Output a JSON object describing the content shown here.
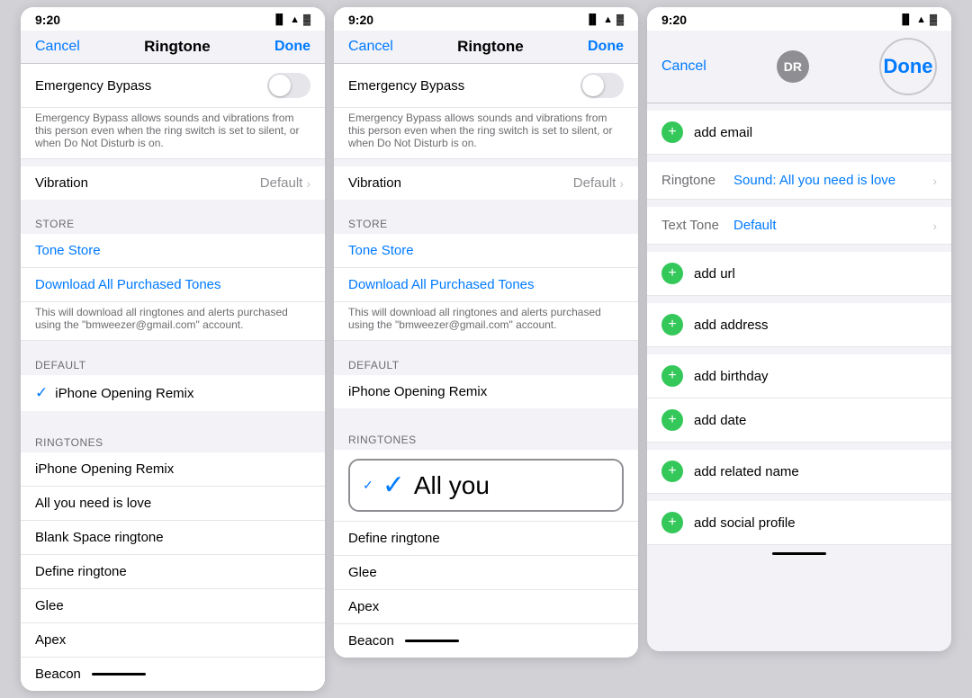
{
  "panel1": {
    "status": {
      "time": "9:20",
      "arrow": "↑"
    },
    "nav": {
      "cancel": "Cancel",
      "title": "Ringtone",
      "done": "Done"
    },
    "emergency": {
      "label": "Emergency Bypass",
      "description": "Emergency Bypass allows sounds and vibrations from this person even when the ring switch is set to silent, or when Do Not Disturb is on."
    },
    "vibration": {
      "label": "Vibration",
      "value": "Default"
    },
    "store_header": "STORE",
    "tone_store": "Tone Store",
    "download_tones": "Download All Purchased Tones",
    "download_desc": "This will download all ringtones and alerts purchased using the \"bmweezer@gmail.com\" account.",
    "default_header": "DEFAULT",
    "default_item": "iPhone Opening Remix",
    "ringtones_header": "RINGTONES",
    "ringtones": [
      "iPhone Opening Remix",
      "All you need is love",
      "Blank Space ringtone",
      "Define ringtone",
      "Glee",
      "Apex",
      "Beacon"
    ]
  },
  "panel2": {
    "status": {
      "time": "9:20",
      "arrow": "↑"
    },
    "nav": {
      "cancel": "Cancel",
      "title": "Ringtone",
      "done": "Done"
    },
    "emergency": {
      "label": "Emergency Bypass",
      "description": "Emergency Bypass allows sounds and vibrations from this person even when the ring switch is set to silent, or when Do Not Disturb is on."
    },
    "vibration": {
      "label": "Vibration",
      "value": "Default"
    },
    "store_header": "STORE",
    "tone_store": "Tone Store",
    "download_tones": "Download All Purchased Tones",
    "download_desc": "This will download all ringtones and alerts purchased using the \"bmweezer@gmail.com\" account.",
    "default_header": "DEFAULT",
    "default_item": "iPhone Opening Remix",
    "ringtones_header": "RINGTONES",
    "ringtones": [
      "All you",
      "Define ringtone",
      "Glee",
      "Apex",
      "Beacon"
    ],
    "highlighted": "All you need is love",
    "zoom_text": "All you"
  },
  "panel3": {
    "status": {
      "time": "9:20",
      "arrow": "↑"
    },
    "nav": {
      "cancel": "Cancel",
      "done": "Done"
    },
    "avatar_initials": "DR",
    "add_email": "add email",
    "ringtone_label": "Ringtone",
    "ringtone_value": "Sound: All you need is love",
    "text_tone_label": "Text Tone",
    "text_tone_value": "Default",
    "add_url": "add url",
    "add_address": "add address",
    "add_birthday": "add birthday",
    "add_date": "add date",
    "add_related": "add related name",
    "add_social": "add social profile"
  }
}
